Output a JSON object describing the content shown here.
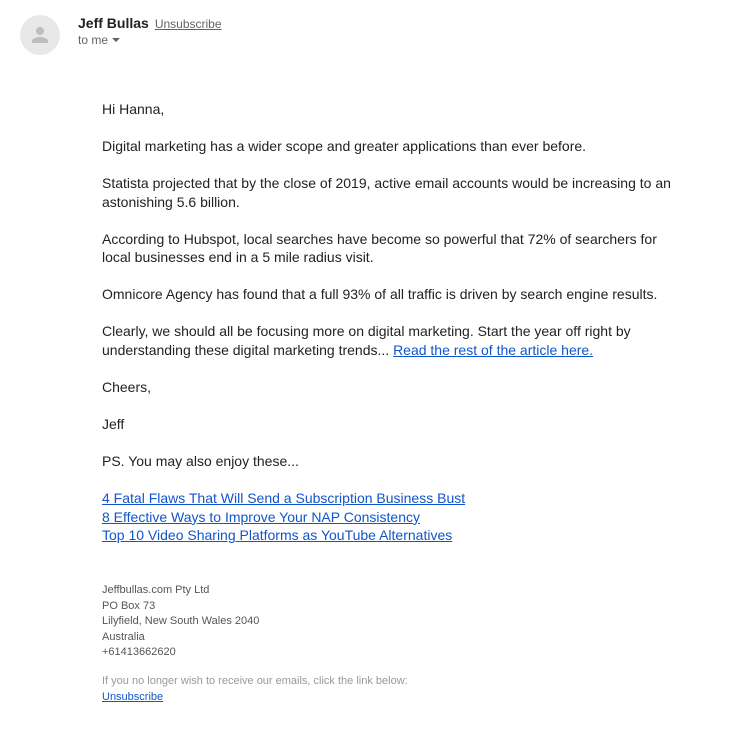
{
  "header": {
    "sender_name": "Jeff Bullas",
    "unsubscribe_label": "Unsubscribe",
    "recipient_text": "to me"
  },
  "body": {
    "greeting": "Hi Hanna,",
    "para1": "Digital marketing has a wider scope and greater applications than ever before.",
    "para2": "Statista projected that by the close of 2019, active email accounts would be increasing to an astonishing 5.6 billion.",
    "para3": "According to Hubspot, local searches have become so powerful that 72% of searchers for local businesses end in a 5 mile radius visit.",
    "para4": "Omnicore Agency has found that a full 93% of all traffic is driven by search engine results.",
    "para5_before_link": "Clearly, we should all be focusing more on digital marketing. Start the year off right by understanding these digital marketing trends... ",
    "para5_link": "Read the rest of the article here.",
    "cheers": "Cheers,",
    "sign_name": "Jeff",
    "ps": "PS. You may also enjoy these...",
    "links": [
      "4 Fatal Flaws That Will Send a Subscription Business Bust",
      "8 Effective Ways to Improve Your NAP Consistency",
      "Top 10 Video Sharing Platforms as YouTube Alternatives"
    ]
  },
  "footer": {
    "company": "Jeffbullas.com Pty Ltd",
    "po_box": "PO Box 73",
    "city": "Lilyfield, New South Wales 2040",
    "country": "Australia",
    "phone": "+61413662620",
    "unsubscribe_text": "If you no longer wish to receive our emails, click the link below:",
    "unsubscribe_link": "Unsubscribe"
  }
}
